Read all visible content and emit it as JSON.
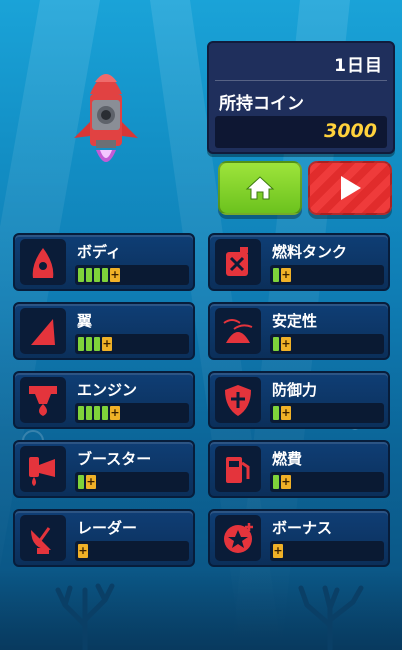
{
  "hud": {
    "day_label": "1日目",
    "coin_label": "所持コイン",
    "coin_value": "3000"
  },
  "buttons": {
    "home_icon": "home-icon",
    "play_icon": "play-icon"
  },
  "upgrades": [
    {
      "label": "ボディ",
      "icon": "body-icon",
      "level": 4
    },
    {
      "label": "燃料タンク",
      "icon": "fuel-tank-icon",
      "level": 1
    },
    {
      "label": "翼",
      "icon": "wing-icon",
      "level": 3
    },
    {
      "label": "安定性",
      "icon": "stability-icon",
      "level": 1
    },
    {
      "label": "エンジン",
      "icon": "engine-icon",
      "level": 4
    },
    {
      "label": "防御力",
      "icon": "shield-icon",
      "level": 1
    },
    {
      "label": "ブースター",
      "icon": "booster-icon",
      "level": 1
    },
    {
      "label": "燃費",
      "icon": "fuel-pump-icon",
      "level": 1
    },
    {
      "label": "レーダー",
      "icon": "radar-icon",
      "level": 0
    },
    {
      "label": "ボーナス",
      "icon": "bonus-icon",
      "level": 0
    }
  ],
  "colors": {
    "level_fill": "#7fd33a",
    "plus": "#f0b127",
    "accent_red": "#e4343c",
    "coin": "#ffd23c"
  }
}
